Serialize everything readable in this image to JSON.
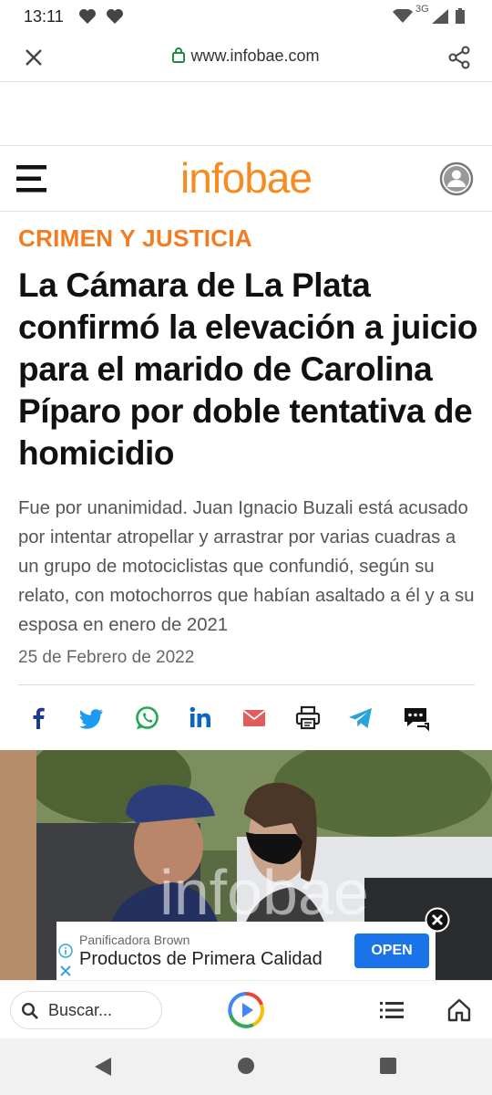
{
  "status_bar": {
    "time": "13:11",
    "network": "3G"
  },
  "browser": {
    "url": "www.infobae.com"
  },
  "site": {
    "logo": "infobae"
  },
  "article": {
    "section": "CRIMEN Y JUSTICIA",
    "headline": "La Cámara de La Plata confirmó la elevación a juicio para el marido de Carolina Píparo por doble tentativa de homicidio",
    "subtitle": "Fue por unanimidad. Juan Ignacio Buzali está acusado por intentar atropellar y arrastrar por varias cuadras a un grupo de motociclistas que confundió, según su relato, con motochorros que habían asaltado a él y a su esposa en enero de 2021",
    "date": "25 de Febrero de 2022",
    "photo_watermark": "infobae"
  },
  "share_icons": [
    "facebook-icon",
    "twitter-icon",
    "whatsapp-icon",
    "linkedin-icon",
    "email-icon",
    "print-icon",
    "telegram-icon",
    "comments-icon"
  ],
  "ad": {
    "advertiser": "Panificadora Brown",
    "title": "Productos de Primera Calidad",
    "cta": "OPEN"
  },
  "bottom_bar": {
    "search_placeholder": "Buscar..."
  },
  "colors": {
    "brand": "#f68b1f",
    "section": "#f47c20",
    "ad_button": "#1a73e8"
  }
}
